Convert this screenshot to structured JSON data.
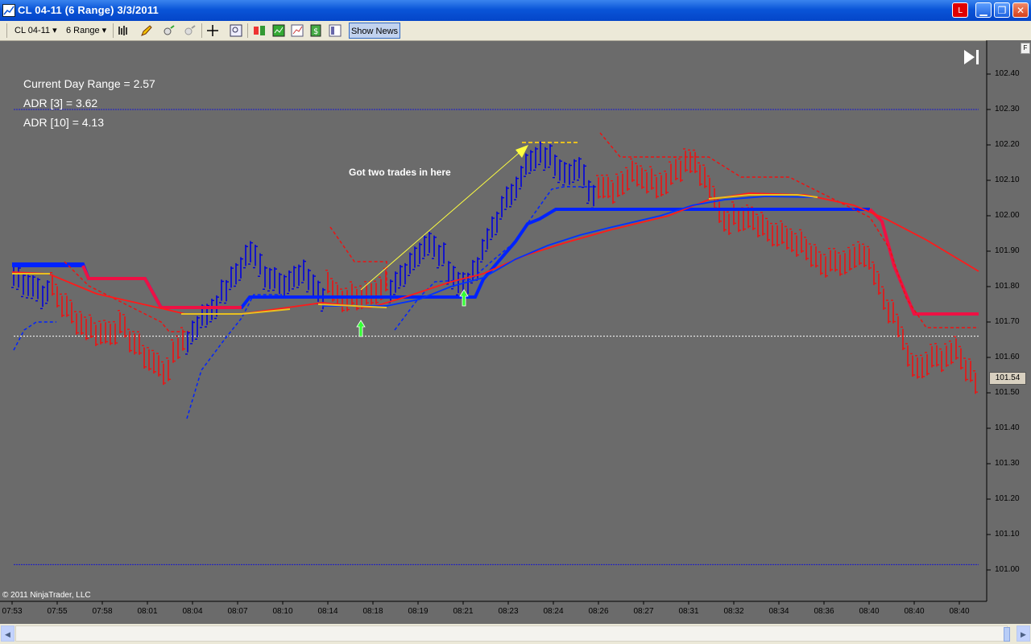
{
  "window": {
    "title": "CL 04-11 (6 Range)   3/3/2011",
    "buttons": {
      "link": "L",
      "minimize": "▁",
      "maximize": "❐",
      "close": "✕"
    }
  },
  "toolbar": {
    "instrument": "CL 04-11",
    "period": "6 Range",
    "show_news": "Show News",
    "icons": [
      "bar-style-icon",
      "draw-pencil-icon",
      "zoom-in-icon",
      "zoom-out-icon",
      "crosshair-icon",
      "zoom-window-icon",
      "strategies-icon",
      "indicators-icon",
      "chart-trader-icon",
      "data-box-icon",
      "properties-icon"
    ]
  },
  "overlay": {
    "current_day_range": "Current Day Range = 2.57",
    "adr3": "ADR [3] = 3.62",
    "adr10": "ADR [10] = 4.13",
    "annotation": "Got two trades in here",
    "copyright": "© 2011 NinjaTrader, LLC",
    "f_button": "F",
    "last_price": "101.54"
  },
  "chart_data": {
    "type": "bar",
    "y_ticks": [
      "102.40",
      "102.30",
      "102.20",
      "102.10",
      "102.00",
      "101.90",
      "101.80",
      "101.70",
      "101.60",
      "101.50",
      "101.40",
      "101.30",
      "101.20",
      "101.10",
      "101.00"
    ],
    "x_ticks": [
      "07:53",
      "07:55",
      "07:58",
      "08:01",
      "08:04",
      "08:07",
      "08:10",
      "08:14",
      "08:18",
      "08:19",
      "08:21",
      "08:23",
      "08:24",
      "08:26",
      "08:27",
      "08:31",
      "08:32",
      "08:34",
      "08:36",
      "08:40",
      "08:40",
      "08:40"
    ],
    "ylim": [
      100.97,
      102.43
    ],
    "reference_lines": {
      "upper_dotted": 102.3,
      "lower_dotted": 101.015,
      "white_dotted": 101.66
    },
    "colors": {
      "up": "#0000dd",
      "down": "#ee1111",
      "ma_fast": "#ff1a1a",
      "ma_slow": "#0033ff",
      "yellow": "#e8c020",
      "arrow_green": "#33ff33",
      "background": "#6b6b6b"
    }
  }
}
